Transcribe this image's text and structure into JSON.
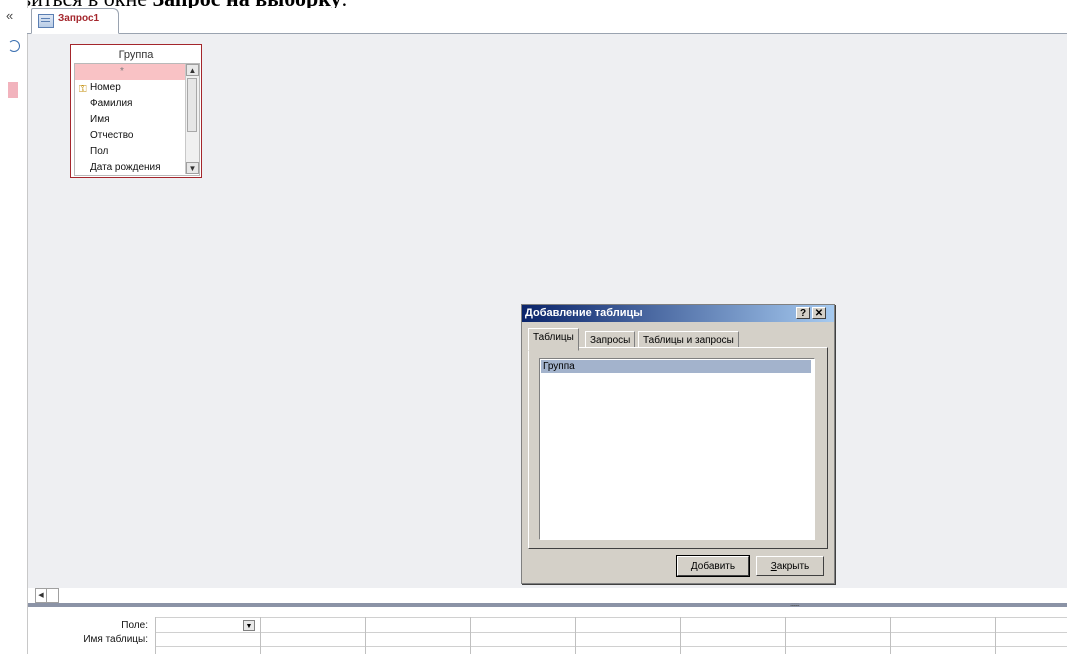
{
  "document_text": {
    "prefix": "оявиться в окне ",
    "bold": "Запрос на выборку",
    "suffix": "."
  },
  "left_pane": {
    "collapse_glyph": "«"
  },
  "tabs": [
    {
      "label": "Запрос1",
      "icon": "query-icon"
    }
  ],
  "field_list": {
    "title": "Группа",
    "items": [
      {
        "label": "*",
        "selected": true
      },
      {
        "label": "Номер",
        "key": true,
        "icon": "key-icon"
      },
      {
        "label": "Фамилия"
      },
      {
        "label": "Имя"
      },
      {
        "label": "Отчество"
      },
      {
        "label": "Пол"
      },
      {
        "label": "Дата рождения"
      }
    ]
  },
  "dialog": {
    "title": "Добавление таблицы",
    "help_button": "?",
    "close_button": "✕",
    "tabs": [
      "Таблицы",
      "Запросы",
      "Таблицы и запросы"
    ],
    "active_tab": "Таблицы",
    "list_items": [
      "Группа"
    ],
    "add_button": {
      "accel": "Д",
      "rest": "обавить"
    },
    "close_btn": {
      "accel": "З",
      "rest": "акрыть"
    }
  },
  "query_grid": {
    "row_labels": [
      "Поле:",
      "Имя таблицы:"
    ]
  },
  "colors": {
    "tab_text": "#a4262c",
    "field_list_border": "#a4262c",
    "selected_field_bg": "#f9c2c5",
    "dialog_title_start": "#0a246a",
    "dialog_title_end": "#a6caf0",
    "design_bg": "#eeeff2"
  }
}
